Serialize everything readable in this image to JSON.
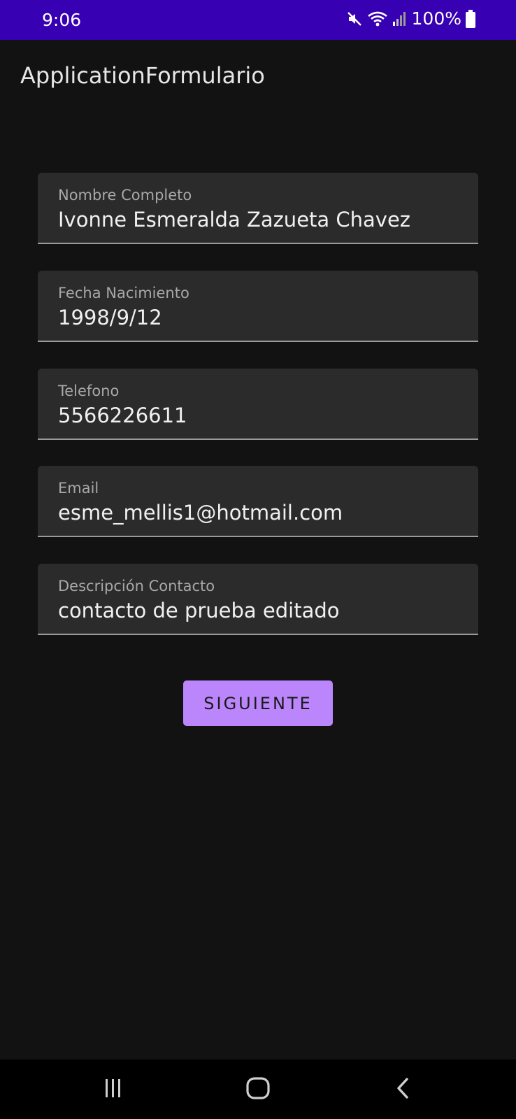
{
  "status_bar": {
    "time": "9:06",
    "battery_percent": "100%",
    "icons": [
      "mute-icon",
      "wifi-icon",
      "signal-icon",
      "battery-icon"
    ]
  },
  "app_bar": {
    "title": "ApplicationFormulario"
  },
  "form": {
    "fields": [
      {
        "label": "Nombre Completo",
        "value": "Ivonne Esmeralda Zazueta Chavez"
      },
      {
        "label": "Fecha Nacimiento",
        "value": "1998/9/12"
      },
      {
        "label": "Telefono",
        "value": "5566226611"
      },
      {
        "label": "Email",
        "value": "esme_mellis1@hotmail.com"
      },
      {
        "label": "Descripción Contacto",
        "value": "contacto de prueba editado"
      }
    ],
    "submit_label": "SIGUIENTE"
  },
  "nav_bar": {
    "icons": [
      "recents-icon",
      "home-icon",
      "back-icon"
    ]
  },
  "colors": {
    "status_bar": "#3700b3",
    "background": "#121212",
    "field_background": "#2b2b2b",
    "button": "#bb86fc"
  }
}
